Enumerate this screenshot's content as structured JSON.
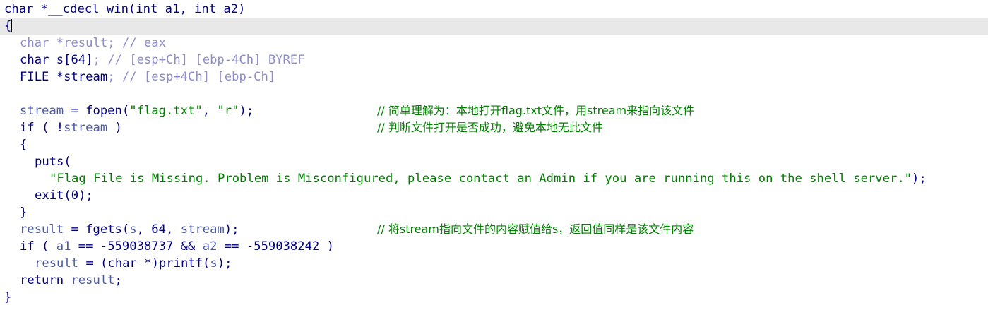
{
  "code": {
    "signature": "char *__cdecl win(int a1, int a2)",
    "open_brace": "{",
    "decl_result_type": "char *",
    "decl_result_name": "result",
    "decl_result_comment": "; // eax",
    "decl_s_type": "char ",
    "decl_s_name": "s[64]",
    "decl_s_comment": "; // [esp+Ch] [ebp-4Ch] BYREF",
    "decl_stream_type": "FILE *",
    "decl_stream_name": "stream",
    "decl_stream_comment": "; // [esp+4Ch] [ebp-Ch]",
    "line_fopen_var": "stream",
    "line_fopen_call": " = fopen(",
    "line_fopen_arg1": "\"flag.txt\"",
    "line_fopen_sep": ", ",
    "line_fopen_arg2": "\"r\"",
    "line_fopen_end": ");",
    "note_fopen": "// 简单理解为：本地打开flag.txt文件，用stream来指向该文件",
    "line_if1_start": "if ( !",
    "line_if1_var": "stream",
    "line_if1_end": " )",
    "note_if1": "// 判断文件打开是否成功，避免本地无此文件",
    "block_open": "{",
    "puts_call": "puts(",
    "puts_string": "\"Flag File is Missing. Problem is Misconfigured, please contact an Admin if you are running this on the shell server.\"",
    "puts_end": ");",
    "exit_call": "exit(0);",
    "block_close": "}",
    "line_fgets_var": "result",
    "line_fgets_call": " = fgets(",
    "line_fgets_arg1": "s",
    "line_fgets_mid": ", 64, ",
    "line_fgets_arg3": "stream",
    "line_fgets_end": ");",
    "note_fgets": "// 将stream指向文件的内容赋值给s，返回值同样是该文件内容",
    "line_if2_start": "if ( ",
    "line_if2_a1": "a1",
    "line_if2_mid": " == -559038737 && ",
    "line_if2_a2": "a2",
    "line_if2_end": " == -559038242 )",
    "line_printf_var": "result",
    "line_printf_mid": " = (char *)printf(",
    "line_printf_arg": "s",
    "line_printf_end": ");",
    "return_kw": "return ",
    "return_var": "result",
    "return_end": ";",
    "close_brace": "}"
  },
  "colors": {
    "keyword": "#000080",
    "variable": "#4a5aa0",
    "string": "#008000",
    "comment": "#8d8dc8",
    "current_line": "#e8e8e8"
  }
}
